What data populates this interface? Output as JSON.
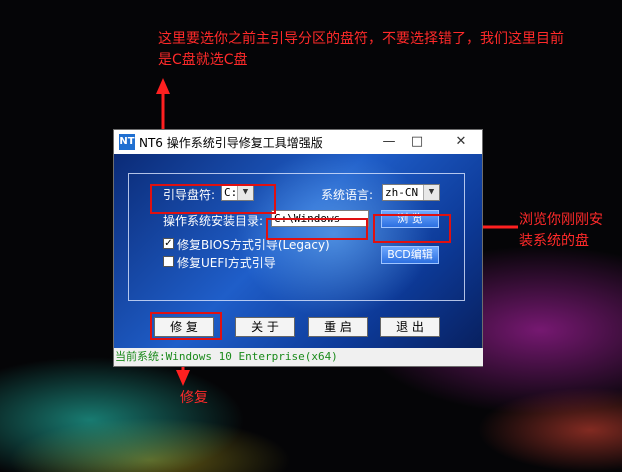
{
  "annotations": {
    "top": [
      "这里要选你之前主引导分区的盘符，不要选择错了，我们这里目前",
      "是C盘就选C盘"
    ],
    "right": [
      "浏览你刚刚安",
      "装系统的盘"
    ],
    "bottom": "修复"
  },
  "window": {
    "title": "NT6 操作系统引导修复工具增强版",
    "icon_text": "NT",
    "controls": {
      "minimize": "—",
      "maximize": "□",
      "close": "✕"
    }
  },
  "form": {
    "drive_label": "引导盘符:",
    "drive_value": "C:",
    "language_label": "系统语言:",
    "language_value": "zh-CN",
    "install_dir_label": "操作系统安装目录:",
    "install_dir_value": "C:\\Windows",
    "browse_label": "浏 览",
    "bios_label": "修复BIOS方式引导(Legacy)",
    "bios_checked": true,
    "uefi_label": "修复UEFI方式引导",
    "uefi_checked": false,
    "edit_label": "BCD编辑"
  },
  "buttons": {
    "repair": "修 复",
    "about": "关 于",
    "reboot": "重 启",
    "exit": "退 出"
  },
  "status": "当前系统:Windows 10 Enterprise(x64)",
  "colors": {
    "annotation": "#ff2a2a",
    "status_text": "#1a8a1a",
    "highlight": "#e01010"
  }
}
